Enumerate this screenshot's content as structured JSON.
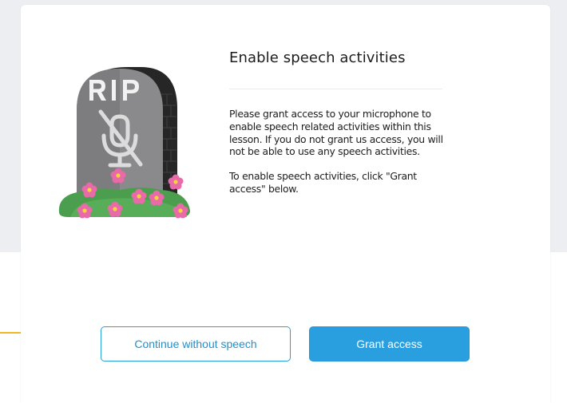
{
  "dialog": {
    "title": "Enable speech activities",
    "paragraphs": [
      "Please grant access to your microphone to enable speech related activities within this lesson. If you do not grant us access, you will not be able to use any speech activities.",
      "To enable speech activities, click \"Grant access\" below."
    ],
    "illustration": {
      "icon": "tombstone-muted-microphone-icon",
      "engraving": "RIP"
    },
    "buttons": {
      "secondary_label": "Continue without speech",
      "primary_label": "Grant access"
    }
  },
  "colors": {
    "accent": "#2a9fe0",
    "highlight_line": "#f2b824",
    "text": "#1c1c1c"
  }
}
